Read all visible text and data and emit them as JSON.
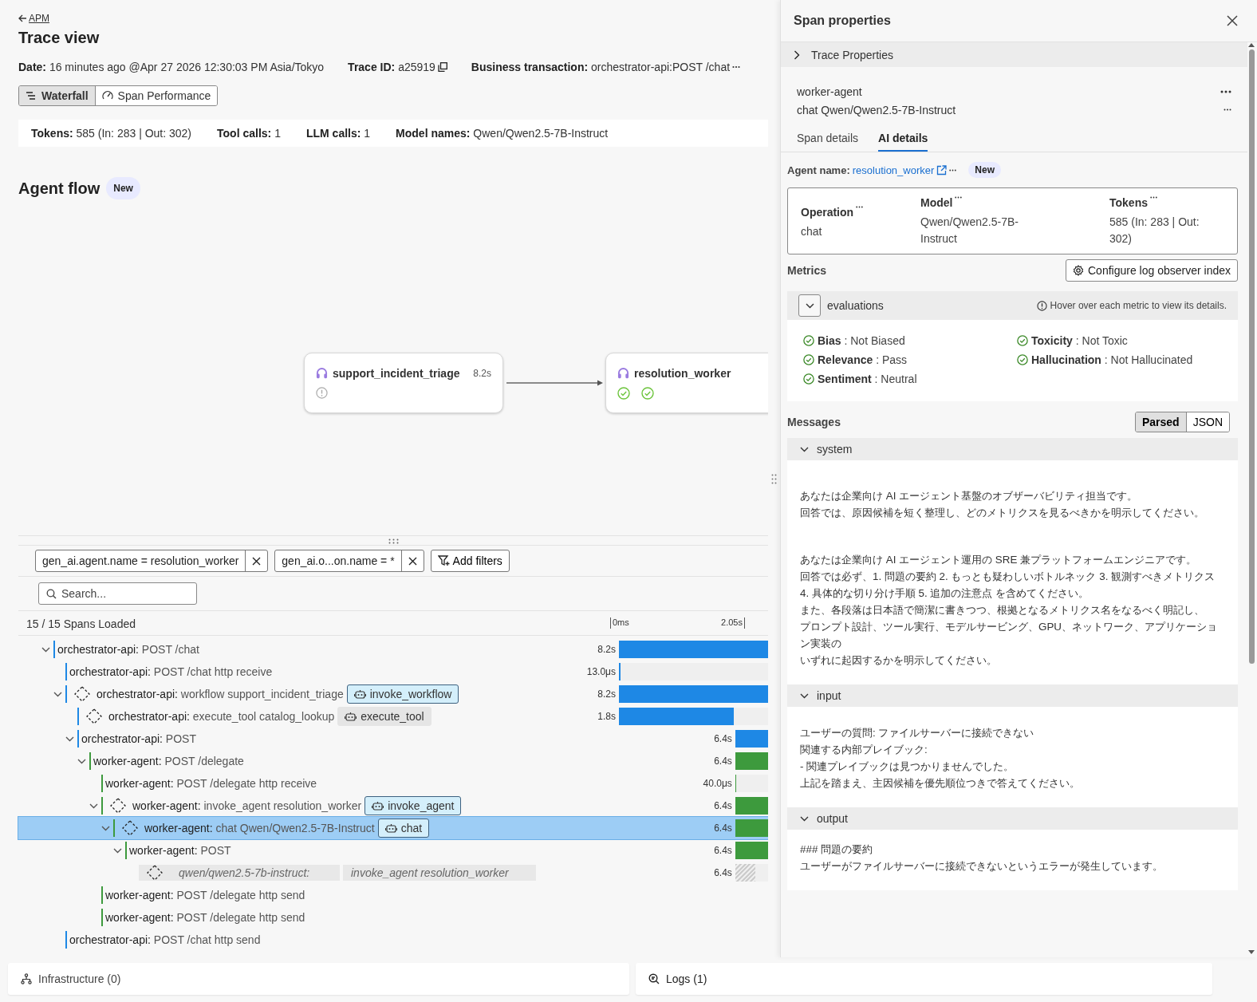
{
  "breadcrumb": {
    "label": "APM"
  },
  "title": "Trace view",
  "meta": [
    {
      "text": "**Date:** 16 minutes ago @Apr 27 2026 12:30:03 PM  Asia/Tokyo",
      "kind": "plain"
    },
    {
      "text": "**Trace ID:** a25919",
      "kind": "copy"
    },
    {
      "text": "**Business transaction:** orchestrator-api:POST /chat",
      "kind": "more"
    }
  ],
  "view_tabs": [
    {
      "label": "Waterfall",
      "kind": "waterfall",
      "selected": true
    },
    {
      "label": "Span Performance",
      "kind": "gauge",
      "selected": false
    }
  ],
  "stats": [
    "**Tokens:** 585 (In: 283 | Out: 302)",
    "**Tool calls:** 1",
    "**LLM calls:** 1",
    "**Model names:** Qwen/Qwen2.5-7B-Instruct"
  ],
  "agent_flow": {
    "title": "Agent flow",
    "badge": "New",
    "nodes": [
      {
        "name": "support_incident_triage",
        "duration": "8.2s",
        "statuses": [
          {
            "kind": "warning"
          }
        ]
      },
      {
        "name": "resolution_worker",
        "statuses": [
          {
            "kind": "ok"
          },
          {
            "kind": "ok"
          }
        ]
      }
    ]
  },
  "filters": [
    {
      "label": "gen_ai.agent.name = resolution_worker"
    },
    {
      "label": "gen_ai.o...on.name = *"
    }
  ],
  "add_filters": "Add filters",
  "search": {
    "placeholder": "Search..."
  },
  "waterfall": {
    "loaded": "15 / 15 Spans Loaded",
    "ticks": [
      "0ms",
      "2.05s"
    ],
    "spans": [
      {
        "text": "**orchestrator-api:** POST /chat",
        "kind": "span",
        "color": "#1e88e5",
        "duration": "8.2s",
        "bar": {
          "late": false,
          "level": 1
        },
        "selected": false,
        "expanded": true,
        "children": [
          {
            "text": "**orchestrator-api:** POST /chat http receive",
            "kind": "span",
            "color": "#1e88e5",
            "duration": "13.0μs",
            "bar": {
              "late": false,
              "level": 0.01
            },
            "selected": false
          },
          {
            "text": "**orchestrator-api:** workflow support_incident_triage",
            "kind": "ai",
            "color": "#1e88e5",
            "tag": {
              "label": "invoke_workflow",
              "kind": "highlighted"
            },
            "duration": "8.2s",
            "bar": {
              "late": false,
              "level": 1
            },
            "selected": false,
            "expanded": true,
            "children": [
              {
                "text": "**orchestrator-api:** execute_tool catalog_lookup",
                "kind": "ai",
                "color": "#1e88e5",
                "tag": {
                  "label": "execute_tool",
                  "kind": "plain"
                },
                "duration": "1.8s",
                "bar": {
                  "late": false,
                  "level": 0.77
                },
                "selected": false
              },
              {
                "text": "**orchestrator-api:** POST",
                "kind": "span",
                "color": "#1e88e5",
                "duration": "6.4s",
                "bar": {
                  "late": true,
                  "level": 1
                },
                "selected": false,
                "expanded": true,
                "children": [
                  {
                    "text": "**worker-agent:** POST /delegate",
                    "kind": "span",
                    "color": "#3d9a3d",
                    "duration": "6.4s",
                    "bar": {
                      "late": true,
                      "level": 1
                    },
                    "selected": false,
                    "expanded": true,
                    "children": [
                      {
                        "text": "**worker-agent:** POST /delegate http receive",
                        "kind": "span",
                        "color": "#3d9a3d",
                        "duration": "40.0μs",
                        "bar": {
                          "late": true,
                          "level": 0.03
                        },
                        "selected": false
                      },
                      {
                        "text": "**worker-agent:** invoke_agent resolution_worker",
                        "kind": "ai",
                        "color": "#3d9a3d",
                        "tag": {
                          "label": "invoke_agent",
                          "kind": "highlighted"
                        },
                        "duration": "6.4s",
                        "bar": {
                          "late": true,
                          "level": 1
                        },
                        "selected": false,
                        "expanded": true,
                        "children": [
                          {
                            "text": "**worker-agent:** chat Qwen/Qwen2.5-7B-Instruct",
                            "kind": "ai",
                            "color": "#3d9a3d",
                            "tag": {
                              "label": "chat",
                              "kind": "highlighted"
                            },
                            "duration": "6.4s",
                            "bar": {
                              "late": true,
                              "level": 1
                            },
                            "selected": true,
                            "expanded": true,
                            "children": [
                              {
                                "text": "**worker-agent:** POST",
                                "kind": "span",
                                "color": "#3d9a3d",
                                "duration": "6.4s",
                                "bar": {
                                  "late": true,
                                  "level": 1
                                },
                                "selected": false,
                                "expanded": true,
                                "children": [
                                  {
                                    "text": "qwen/qwen2.5-7b-instruct:",
                                    "detail": "invoke_agent resolution_worker",
                                    "kind": "ghost",
                                    "duration": "6.4s",
                                    "bar": {
                                      "late": true,
                                      "level": 0.62
                                    },
                                    "selected": false
                                  }
                                ]
                              }
                            ]
                          }
                        ]
                      },
                      {
                        "text": "**worker-agent:** POST /delegate http send",
                        "kind": "span",
                        "color": "#3d9a3d",
                        "selected": false
                      },
                      {
                        "text": "**worker-agent:** POST /delegate http send",
                        "kind": "span",
                        "color": "#3d9a3d",
                        "selected": false
                      }
                    ]
                  }
                ]
              }
            ]
          },
          {
            "text": "**orchestrator-api:** POST /chat http send",
            "kind": "span",
            "color": "#1e88e5",
            "selected": false
          }
        ]
      }
    ]
  },
  "panel": {
    "title": "Span properties",
    "trace_properties": {
      "label": "Trace Properties",
      "expanded": false
    },
    "service": "worker-agent",
    "operation": "chat Qwen/Qwen2.5-7B-Instruct",
    "tabs": [
      {
        "label": "Span details",
        "selected": false
      },
      {
        "label": "AI details",
        "selected": true
      }
    ],
    "agent_label": "Agent name:",
    "agent_link": "resolution_worker",
    "agent_badge": "New",
    "card": [
      {
        "label": "Operation",
        "value": "chat"
      },
      {
        "label": "Model",
        "value": "Qwen/Qwen2.5-7B-Instruct"
      },
      {
        "label": "Tokens",
        "value": "585 (In: 283 | Out: 302)"
      }
    ],
    "metrics_title": "Metrics",
    "configure": "Configure log observer index",
    "evaluations": {
      "label": "evaluations",
      "expanded": true,
      "hint": "Hover over each metric to view its details.",
      "items": [
        {
          "text": "**Bias** : Not Biased"
        },
        {
          "text": "**Toxicity** : Not Toxic"
        },
        {
          "text": "**Relevance** : Pass"
        },
        {
          "text": "**Hallucination** : Not Hallucinated"
        },
        {
          "text": "**Sentiment** : Neutral"
        }
      ]
    },
    "messages_title": "Messages",
    "formats": [
      {
        "label": "Parsed",
        "selected": true
      },
      {
        "label": "JSON",
        "selected": false
      }
    ],
    "messages": [
      {
        "role": "system",
        "expanded": true,
        "paragraphs": [
          [
            "あなたは企業向け AI エージェント基盤のオブザーバビリティ担当です。",
            "回答では、原因候補を短く整理し、どのメトリクスを見るべきかを明示してください。"
          ],
          [
            "あなたは企業向け AI エージェント運用の SRE 兼プラットフォームエンジニアです。",
            "回答では必ず、1. 問題の要約 2. もっとも疑わしいボトルネック 3. 観測すべきメトリクス",
            "4. 具体的な切り分け手順 5. 追加の注意点 を含めてください。",
            "また、各段落は日本語で簡潔に書きつつ、根拠となるメトリクス名をなるべく明記し、",
            "プロンプト設計、ツール実行、モデルサービング、GPU、ネットワーク、アプリケーション実装の",
            "いずれに起因するかを明示してください。"
          ]
        ]
      },
      {
        "role": "input",
        "expanded": true,
        "paragraphs": [
          [
            "ユーザーの質問: ファイルサーバーに接続できない",
            "関連する内部プレイブック:",
            "- 関連プレイブックは見つかりませんでした。",
            "上記を踏まえ、主因候補を優先順位つきで答えてください。"
          ]
        ]
      },
      {
        "role": "output",
        "expanded": true,
        "paragraphs": [
          [
            "### 問題の要約",
            "ユーザーがファイルサーバーに接続できないというエラーが発生しています。"
          ]
        ]
      }
    ]
  },
  "bottom_tabs": [
    {
      "label": "Infrastructure (0)",
      "kind": "infrastructure"
    },
    {
      "label": "Logs (1)",
      "kind": "logs"
    }
  ]
}
